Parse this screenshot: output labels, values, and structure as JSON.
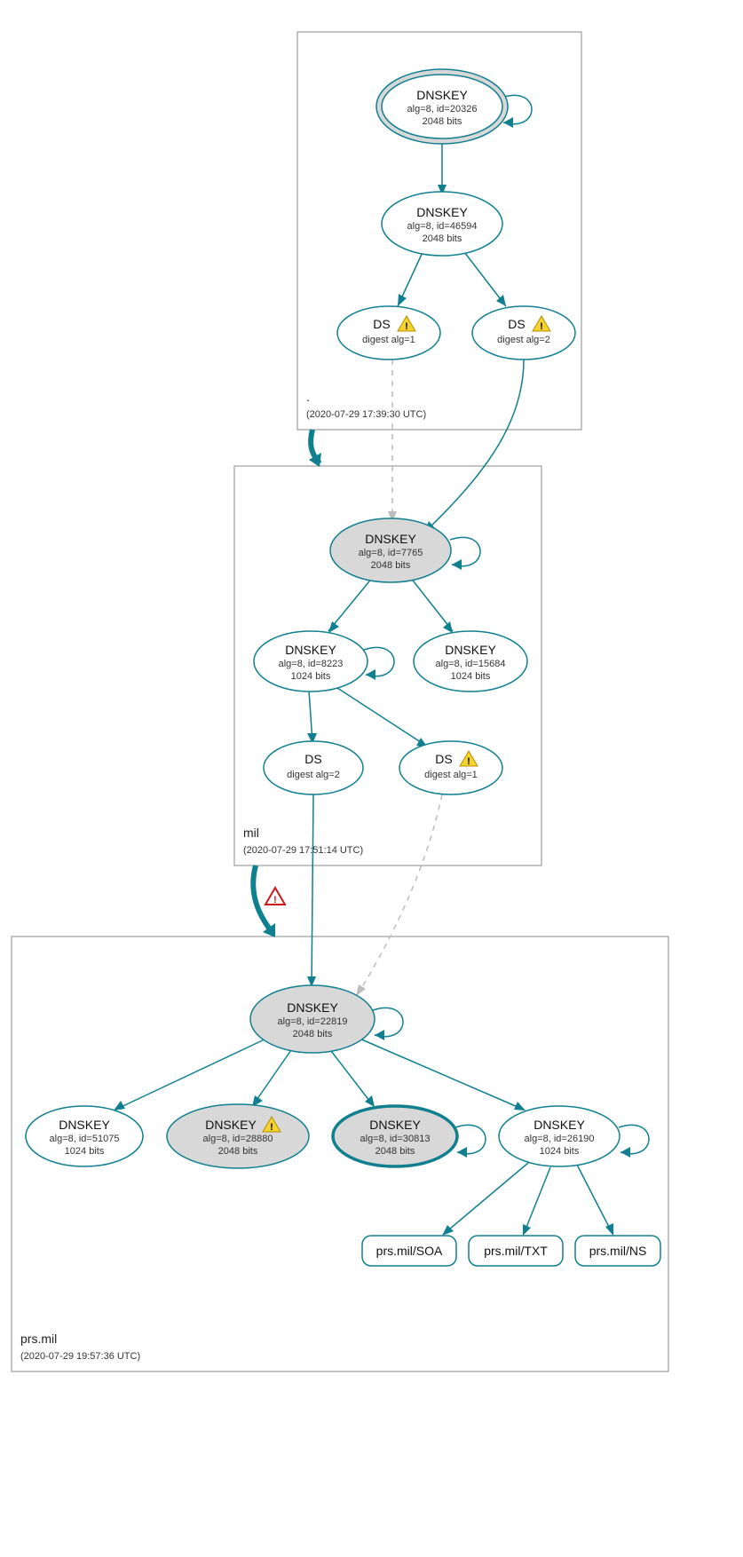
{
  "colors": {
    "stroke": "#107f90",
    "shaded": "#d8d8d8",
    "gray": "#bcbcbc",
    "warn": "#f6d22c",
    "warn_red": "#cc1a1a"
  },
  "zones": {
    "root": {
      "name": ".",
      "timestamp": "(2020-07-29 17:39:30 UTC)"
    },
    "mil": {
      "name": "mil",
      "timestamp": "(2020-07-29 17:51:14 UTC)"
    },
    "prsmil": {
      "name": "prs.mil",
      "timestamp": "(2020-07-29 19:57:36 UTC)"
    }
  },
  "nodes": {
    "root_ksk": {
      "title": "DNSKEY",
      "sub1": "alg=8, id=20326",
      "sub2": "2048 bits"
    },
    "root_zsk": {
      "title": "DNSKEY",
      "sub1": "alg=8, id=46594",
      "sub2": "2048 bits"
    },
    "root_ds1": {
      "title": "DS",
      "sub1": "digest alg=1"
    },
    "root_ds2": {
      "title": "DS",
      "sub1": "digest alg=2"
    },
    "mil_ksk": {
      "title": "DNSKEY",
      "sub1": "alg=8, id=7765",
      "sub2": "2048 bits"
    },
    "mil_zsk1": {
      "title": "DNSKEY",
      "sub1": "alg=8, id=8223",
      "sub2": "1024 bits"
    },
    "mil_zsk2": {
      "title": "DNSKEY",
      "sub1": "alg=8, id=15684",
      "sub2": "1024 bits"
    },
    "mil_ds2": {
      "title": "DS",
      "sub1": "digest alg=2"
    },
    "mil_ds1": {
      "title": "DS",
      "sub1": "digest alg=1"
    },
    "prs_ksk": {
      "title": "DNSKEY",
      "sub1": "alg=8, id=22819",
      "sub2": "2048 bits"
    },
    "prs_k51075": {
      "title": "DNSKEY",
      "sub1": "alg=8, id=51075",
      "sub2": "1024 bits"
    },
    "prs_k28880": {
      "title": "DNSKEY",
      "sub1": "alg=8, id=28880",
      "sub2": "2048 bits"
    },
    "prs_k30813": {
      "title": "DNSKEY",
      "sub1": "alg=8, id=30813",
      "sub2": "2048 bits"
    },
    "prs_k26190": {
      "title": "DNSKEY",
      "sub1": "alg=8, id=26190",
      "sub2": "1024 bits"
    }
  },
  "rrsets": {
    "soa": "prs.mil/SOA",
    "txt": "prs.mil/TXT",
    "ns": "prs.mil/NS"
  }
}
